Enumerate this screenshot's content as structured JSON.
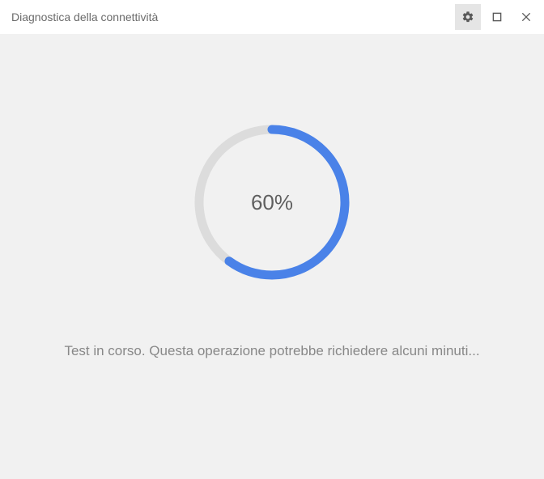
{
  "window": {
    "title": "Diagnostica della connettività"
  },
  "titlebar": {
    "settings_icon": "gear-icon",
    "maximize_icon": "maximize-icon",
    "close_icon": "close-icon"
  },
  "progress": {
    "percent": 60,
    "label": "60%"
  },
  "status": {
    "message": "Test in corso. Questa operazione potrebbe richiedere alcuni minuti..."
  },
  "colors": {
    "ring_bg": "#dcdcdc",
    "ring_fg": "#4a82e8",
    "page_bg": "#f1f1f1"
  }
}
